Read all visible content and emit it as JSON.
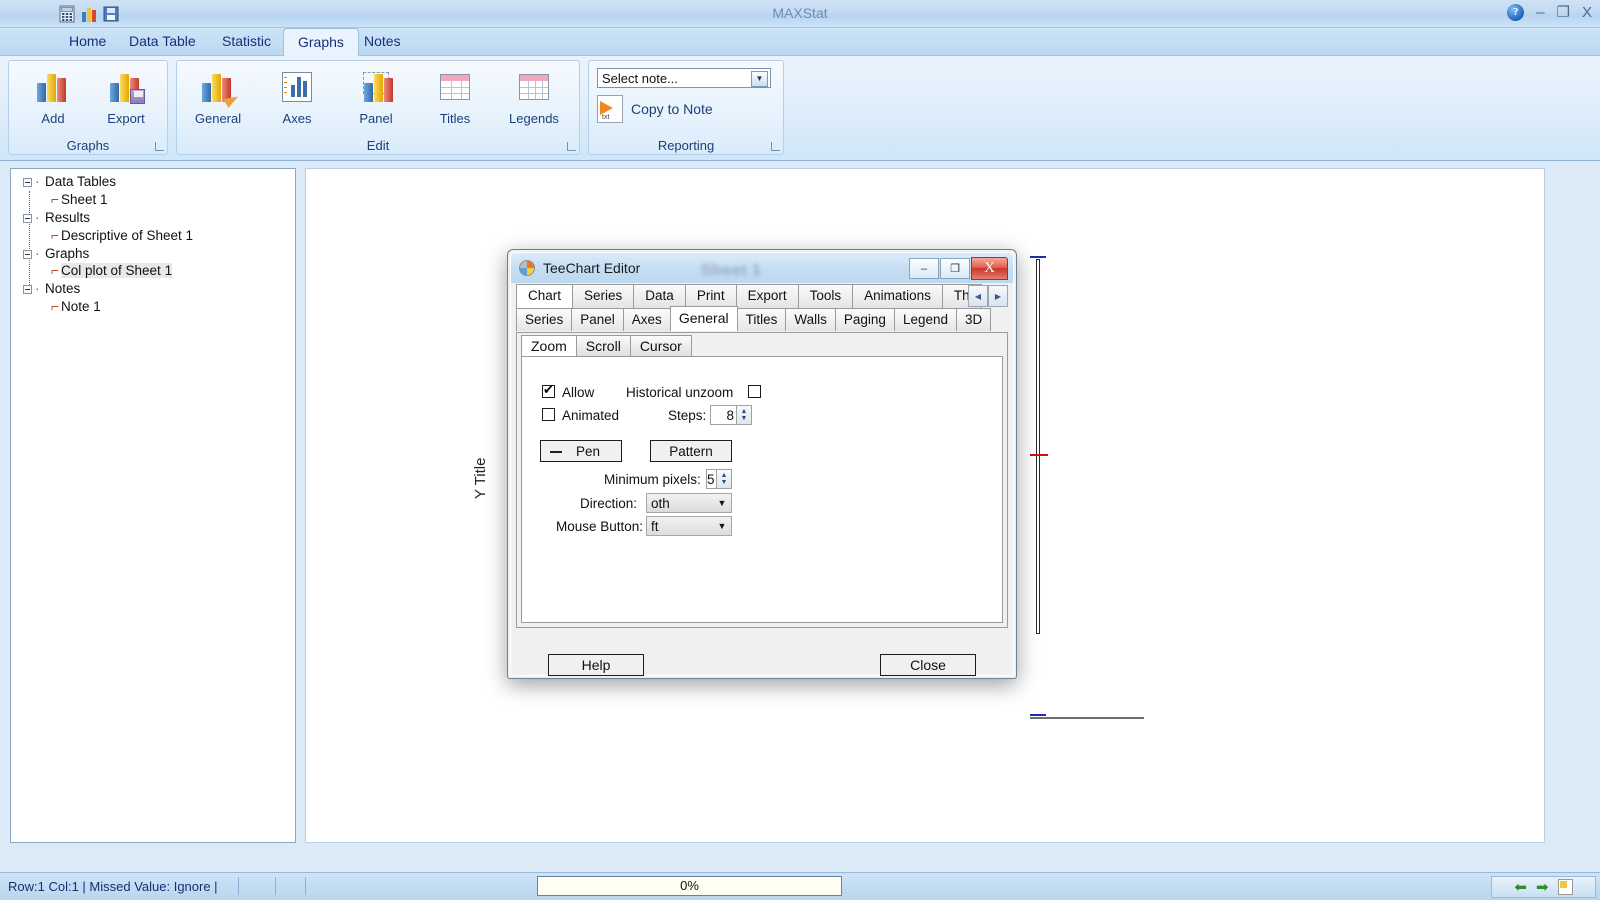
{
  "window": {
    "title": "MAXStat",
    "help_icon": "help-icon",
    "minimize": "–",
    "maximize": "❐",
    "close": "X",
    "quick_access": [
      "calculator-icon",
      "bar-chart-icon",
      "save-icon"
    ]
  },
  "ribbon": {
    "tabs": [
      {
        "label": "Home",
        "active": false
      },
      {
        "label": "Data Table",
        "active": false
      },
      {
        "label": "Statistic",
        "active": false
      },
      {
        "label": "Graphs",
        "active": true
      },
      {
        "label": "Notes",
        "active": false
      }
    ],
    "groups": [
      {
        "name": "Graphs",
        "label": "Graphs",
        "items": [
          {
            "label": "Add",
            "icon": "bar-chart-add-icon"
          },
          {
            "label": "Export",
            "icon": "bar-chart-export-icon"
          }
        ]
      },
      {
        "name": "Edit",
        "label": "Edit",
        "items": [
          {
            "label": "General",
            "icon": "chart-brush-icon"
          },
          {
            "label": "Axes",
            "icon": "axes-icon"
          },
          {
            "label": "Panel",
            "icon": "panel-icon"
          },
          {
            "label": "Titles",
            "icon": "titles-grid-icon"
          },
          {
            "label": "Legends",
            "icon": "legends-grid-icon"
          }
        ]
      },
      {
        "name": "Reporting",
        "label": "Reporting",
        "note_select_value": "Select note...",
        "copy_to_note_label": "Copy to Note"
      }
    ]
  },
  "tree": {
    "nodes": [
      {
        "label": "Data Tables",
        "level": 0,
        "selected": false
      },
      {
        "label": "Sheet 1",
        "level": 1,
        "selected": false
      },
      {
        "label": "Results",
        "level": 0,
        "selected": false
      },
      {
        "label": "Descriptive of Sheet 1",
        "level": 1,
        "selected": false
      },
      {
        "label": "Graphs",
        "level": 0,
        "selected": false
      },
      {
        "label": "Col plot of Sheet 1",
        "level": 1,
        "selected": true
      },
      {
        "label": "Notes",
        "level": 0,
        "selected": false
      },
      {
        "label": "Note 1",
        "level": 1,
        "selected": false
      }
    ]
  },
  "chart": {
    "y_title": "Y Title",
    "watermark_title": "Sheet 1"
  },
  "dialog": {
    "title": "TeeChart Editor",
    "minimize": "–",
    "maximize": "❐",
    "close": "X",
    "main_tabs": [
      {
        "label": "Chart",
        "selected": true
      },
      {
        "label": "Series",
        "selected": false
      },
      {
        "label": "Data",
        "selected": false
      },
      {
        "label": "Print",
        "selected": false
      },
      {
        "label": "Export",
        "selected": false
      },
      {
        "label": "Tools",
        "selected": false
      },
      {
        "label": "Animations",
        "selected": false
      },
      {
        "label": "Th",
        "selected": false
      }
    ],
    "tab_scroll_left": "◀",
    "tab_scroll_right": "▶",
    "sub_tabs": [
      {
        "label": "Series",
        "selected": false
      },
      {
        "label": "Panel",
        "selected": false
      },
      {
        "label": "Axes",
        "selected": false
      },
      {
        "label": "General",
        "selected": true
      },
      {
        "label": "Titles",
        "selected": false
      },
      {
        "label": "Walls",
        "selected": false
      },
      {
        "label": "Paging",
        "selected": false
      },
      {
        "label": "Legend",
        "selected": false
      },
      {
        "label": "3D",
        "selected": false
      }
    ],
    "inner_tabs": [
      {
        "label": "Zoom",
        "selected": true
      },
      {
        "label": "Scroll",
        "selected": false
      },
      {
        "label": "Cursor",
        "selected": false
      }
    ],
    "zoom_panel": {
      "allow_label": "Allow",
      "allow_checked": true,
      "animated_label": "Animated",
      "animated_checked": false,
      "historical_unzoom_label": "Historical unzoom",
      "historical_unzoom_checked": false,
      "steps_label": "Steps:",
      "steps_value": "8",
      "pen_button": "Pen",
      "pattern_button": "Pattern",
      "minimum_pixels_label": "Minimum pixels:",
      "minimum_pixels_value": "5",
      "direction_label": "Direction:",
      "direction_value": "oth",
      "mouse_button_label": "Mouse Button:",
      "mouse_button_value": "ft"
    },
    "help_button": "Help",
    "close_button": "Close"
  },
  "statusbar": {
    "text": "Row:1 Col:1 | Missed Value: Ignore |",
    "progress_label": "0%",
    "nav_back": "⬅",
    "nav_forward": "➡",
    "note_icon": "note-page-icon"
  }
}
